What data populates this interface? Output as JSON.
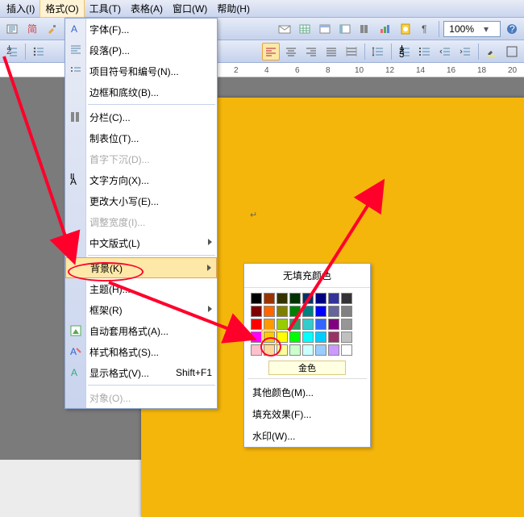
{
  "menubar": {
    "insert": "插入(I)",
    "format": "格式(O)",
    "tools": "工具(T)",
    "table": "表格(A)",
    "window": "窗口(W)",
    "help": "帮助(H)"
  },
  "zoom": {
    "value": "100%"
  },
  "ruler": {
    "t2": "2",
    "t4": "4",
    "t6": "6",
    "t8": "8",
    "t10": "10",
    "t12": "12",
    "t14": "14",
    "t16": "16",
    "t18": "18",
    "t20": "20"
  },
  "dd": {
    "font": "字体(F)...",
    "para": "段落(P)...",
    "bullets": "项目符号和编号(N)...",
    "borders": "边框和底纹(B)...",
    "columns": "分栏(C)...",
    "tabs": "制表位(T)...",
    "dropcap": "首字下沉(D)...",
    "textdir": "文字方向(X)...",
    "case": "更改大小写(E)...",
    "fitwidth": "调整宽度(I)...",
    "cjk": "中文版式(L)",
    "background": "背景(K)",
    "theme": "主题(H)...",
    "frames": "框架(R)",
    "autoformat": "自动套用格式(A)...",
    "styles": "样式和格式(S)...",
    "reveal": "显示格式(V)...",
    "reveal_sc": "Shift+F1",
    "object": "对象(O)..."
  },
  "sub": {
    "nofill": "无填充颜色",
    "gold": "金色",
    "more": "其他颜色(M)...",
    "effects": "填充效果(F)...",
    "watermark": "水印(W)..."
  },
  "chart_data": {
    "type": "table",
    "title": "color palette 8x5",
    "categories": [
      "row0",
      "row1",
      "row2",
      "row3",
      "row4"
    ],
    "series": [
      {
        "name": "c0",
        "values": [
          "#000000",
          "#800000",
          "#ff0000",
          "#ff00ff",
          "#ffc0cb"
        ]
      },
      {
        "name": "c1",
        "values": [
          "#993300",
          "#ff6600",
          "#ff9900",
          "#ffcc00",
          "#ffd89b"
        ]
      },
      {
        "name": "c2",
        "values": [
          "#333300",
          "#808000",
          "#99cc00",
          "#ffff00",
          "#ffff99"
        ]
      },
      {
        "name": "c3",
        "values": [
          "#003300",
          "#008000",
          "#339966",
          "#00ff00",
          "#ccffcc"
        ]
      },
      {
        "name": "c4",
        "values": [
          "#003366",
          "#008080",
          "#33cccc",
          "#00ffff",
          "#ccffff"
        ]
      },
      {
        "name": "c5",
        "values": [
          "#000080",
          "#0000ff",
          "#3366ff",
          "#00ccff",
          "#99ccff"
        ]
      },
      {
        "name": "c6",
        "values": [
          "#333399",
          "#666699",
          "#800080",
          "#993366",
          "#cc99ff"
        ]
      },
      {
        "name": "c7",
        "values": [
          "#333333",
          "#808080",
          "#969696",
          "#c0c0c0",
          "#ffffff"
        ]
      }
    ]
  }
}
